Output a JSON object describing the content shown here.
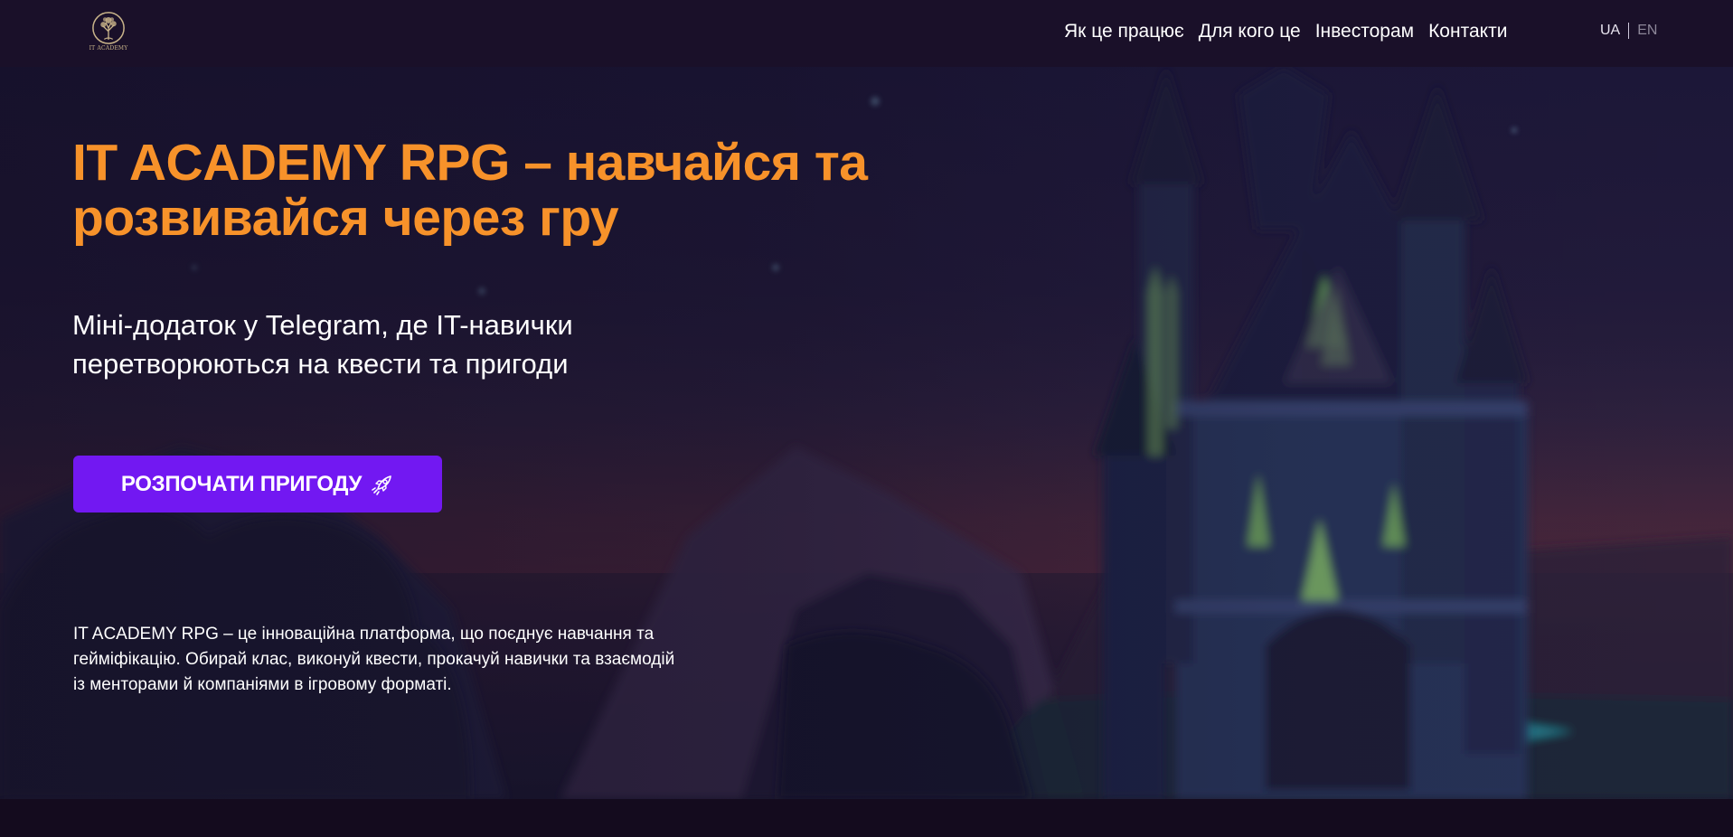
{
  "header": {
    "logo_caption": "IT ACADEMY",
    "nav": [
      {
        "label": "Як це працює"
      },
      {
        "label": "Для кого це"
      },
      {
        "label": "Інвесторам"
      },
      {
        "label": "Контакти"
      }
    ],
    "language": {
      "active": "UA",
      "other": "EN"
    }
  },
  "hero": {
    "title": "IT ACADEMY RPG – навчайся та розвивайся через гру",
    "subtitle": "Міні-додаток у Telegram, де IT-навички перетворюються на квести та пригоди",
    "cta_label": "РОЗПОЧАТИ ПРИГОДУ",
    "cta_icon": "rocket-icon",
    "description": "IT ACADEMY RPG – це інноваційна платформа, що поєднує навчання та гейміфікацію. Обирай клас, виконуй квести, прокачуй навички та взаємодій із менторами й компаніями в ігровому форматі."
  },
  "colors": {
    "accent_orange": "#f7922a",
    "button_purple": "#7218f2",
    "header_bg": "#1a1029",
    "text_white": "#ffffff"
  }
}
